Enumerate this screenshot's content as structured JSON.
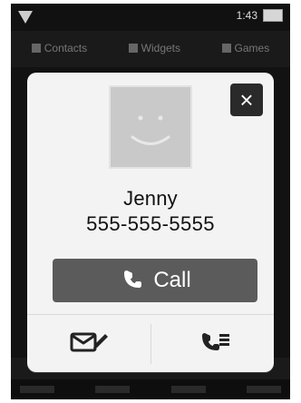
{
  "status_bar": {
    "time": "1:43",
    "battery_level": 0.8,
    "icons": [
      "signal-icon",
      "battery-icon"
    ]
  },
  "tabs": [
    {
      "label": "Contacts"
    },
    {
      "label": "Widgets"
    },
    {
      "label": "Games"
    }
  ],
  "contact_card": {
    "name": "Jenny",
    "number": "555-555-5555",
    "call_label": "Call",
    "colors": {
      "card_bg": "#f3f3f3",
      "call_btn_bg": "#5b5b5b",
      "close_bg": "#2a2a2a"
    },
    "actions": [
      {
        "icon": "message-icon"
      },
      {
        "icon": "call-log-icon"
      }
    ]
  }
}
